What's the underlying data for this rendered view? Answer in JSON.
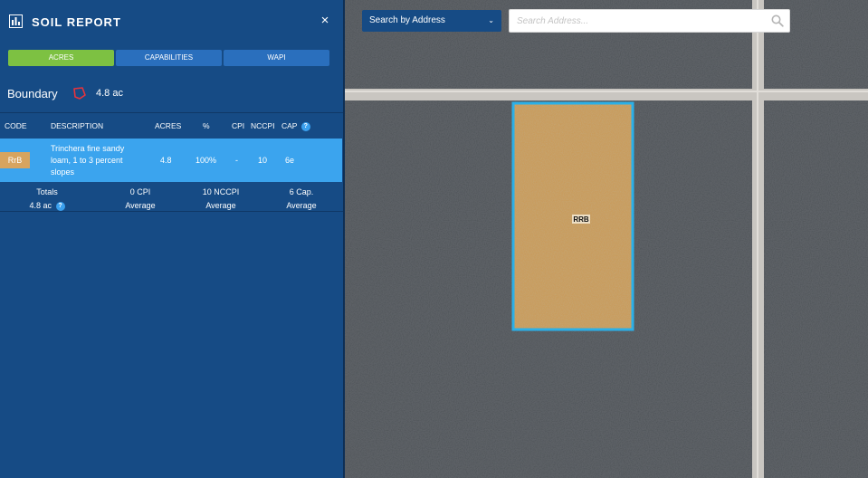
{
  "panel": {
    "title": "SOIL REPORT",
    "close_symbol": "×",
    "tabs": [
      {
        "label": "ACRES",
        "active": true
      },
      {
        "label": "CAPABILITIES",
        "active": false
      },
      {
        "label": "WAPI",
        "active": false
      }
    ],
    "boundary": {
      "label": "Boundary",
      "value": "4.8 ac",
      "icon": "polygon-icon"
    },
    "table": {
      "headers": {
        "code": "CODE",
        "description": "DESCRIPTION",
        "acres": "ACRES",
        "percent": "%",
        "cpi": "CPI",
        "nccpi": "NCCPI",
        "cap": "CAP"
      },
      "rows": [
        {
          "code": "RrB",
          "description": "Trinchera fine sandy loam, 1 to 3 percent slopes",
          "acres": "4.8",
          "percent": "100%",
          "cpi": "-",
          "nccpi": "10",
          "cap": "6e"
        }
      ]
    },
    "totals": {
      "label": "Totals",
      "acres": "4.8 ac",
      "cpi_value": "0 CPI",
      "cpi_label": "Average",
      "nccpi_value": "10 NCCPI",
      "nccpi_label": "Average",
      "cap_value": "6 Cap.",
      "cap_label": "Average"
    }
  },
  "map": {
    "search_mode": "Search by Address",
    "search_placeholder": "Search Address...",
    "parcel_label": "RRB"
  },
  "colors": {
    "panel_bg": "#164b85",
    "active_tab": "#7dc142",
    "selected_row": "#3ba4ee",
    "soil_swatch": "#d7a45f",
    "parcel_fill": "#c89c5d",
    "parcel_outline": "#2bb0e8"
  }
}
